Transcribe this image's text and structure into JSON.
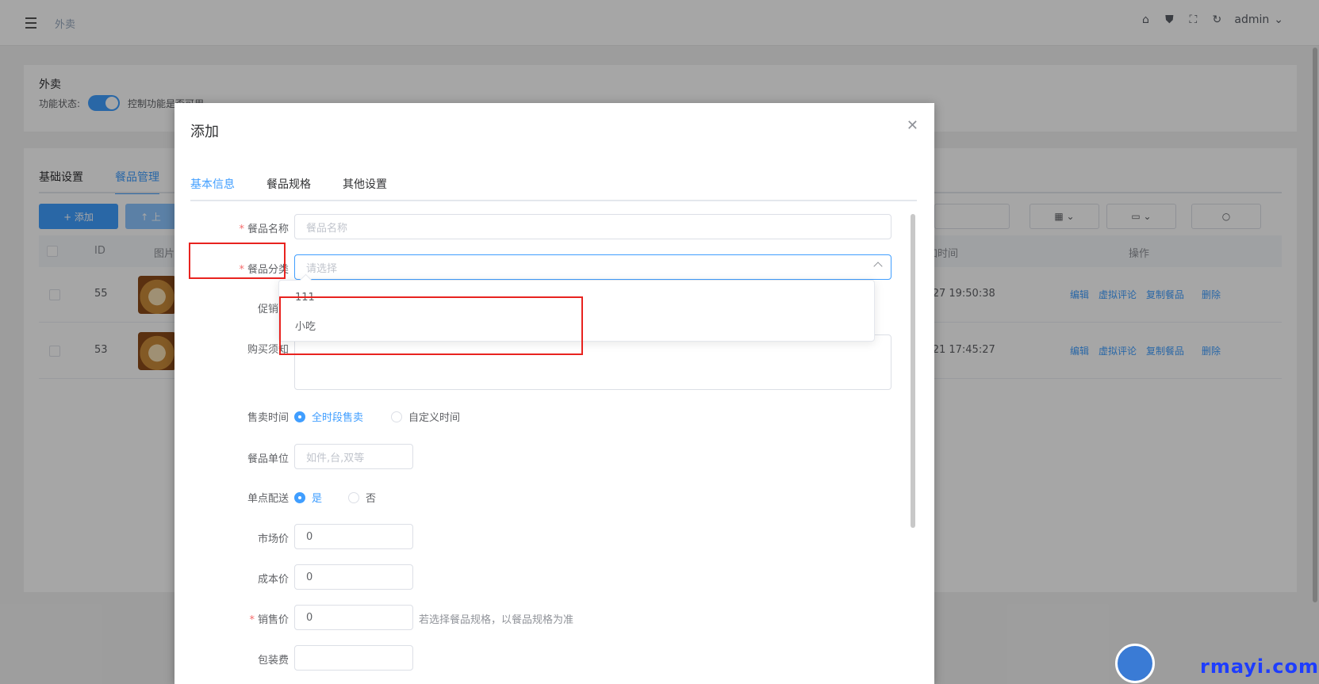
{
  "topbar": {
    "breadcrumb": "外卖",
    "user": "admin"
  },
  "status_card": {
    "title": "外卖",
    "status_label": "功能状态:",
    "status_desc": "控制功能是否可用"
  },
  "list_card": {
    "tabs": [
      "基础设置",
      "餐品管理"
    ],
    "add_button": "+ 添加",
    "upload_button": "↑ 上",
    "columns": {
      "id": "ID",
      "image": "图片",
      "add_time": "加时间",
      "actions": "操作"
    },
    "rows": [
      {
        "id": "55",
        "time": "-27 19:50:38",
        "actions": [
          "编辑",
          "虚拟评论",
          "复制餐品",
          "删除"
        ]
      },
      {
        "id": "53",
        "time": "-21 17:45:27",
        "actions": [
          "编辑",
          "虚拟评论",
          "复制餐品",
          "删除"
        ]
      }
    ]
  },
  "dialog": {
    "title": "添加",
    "tabs": [
      "基本信息",
      "餐品规格",
      "其他设置"
    ],
    "fields": {
      "name": {
        "label": "餐品名称",
        "placeholder": "餐品名称"
      },
      "category": {
        "label": "餐品分类",
        "placeholder": "请选择"
      },
      "promo": {
        "label": "促销语"
      },
      "notice": {
        "label": "购买须知"
      },
      "sale_time": {
        "label": "售卖时间",
        "options": [
          "全时段售卖",
          "自定义时间"
        ]
      },
      "unit": {
        "label": "餐品单位",
        "placeholder": "如件,台,双等"
      },
      "single_delivery": {
        "label": "单点配送",
        "options": [
          "是",
          "否"
        ]
      },
      "market_price": {
        "label": "市场价",
        "value": "0"
      },
      "cost_price": {
        "label": "成本价",
        "value": "0"
      },
      "sale_price": {
        "label": "销售价",
        "value": "0",
        "hint": "若选择餐品规格，以餐品规格为准"
      },
      "packing_fee": {
        "label": "包装费",
        "value": ""
      }
    },
    "category_options": [
      "111",
      "小吃"
    ]
  },
  "watermark": "rmayi.com",
  "colors": {
    "primary": "#409eff",
    "annotation": "#e8231f"
  }
}
